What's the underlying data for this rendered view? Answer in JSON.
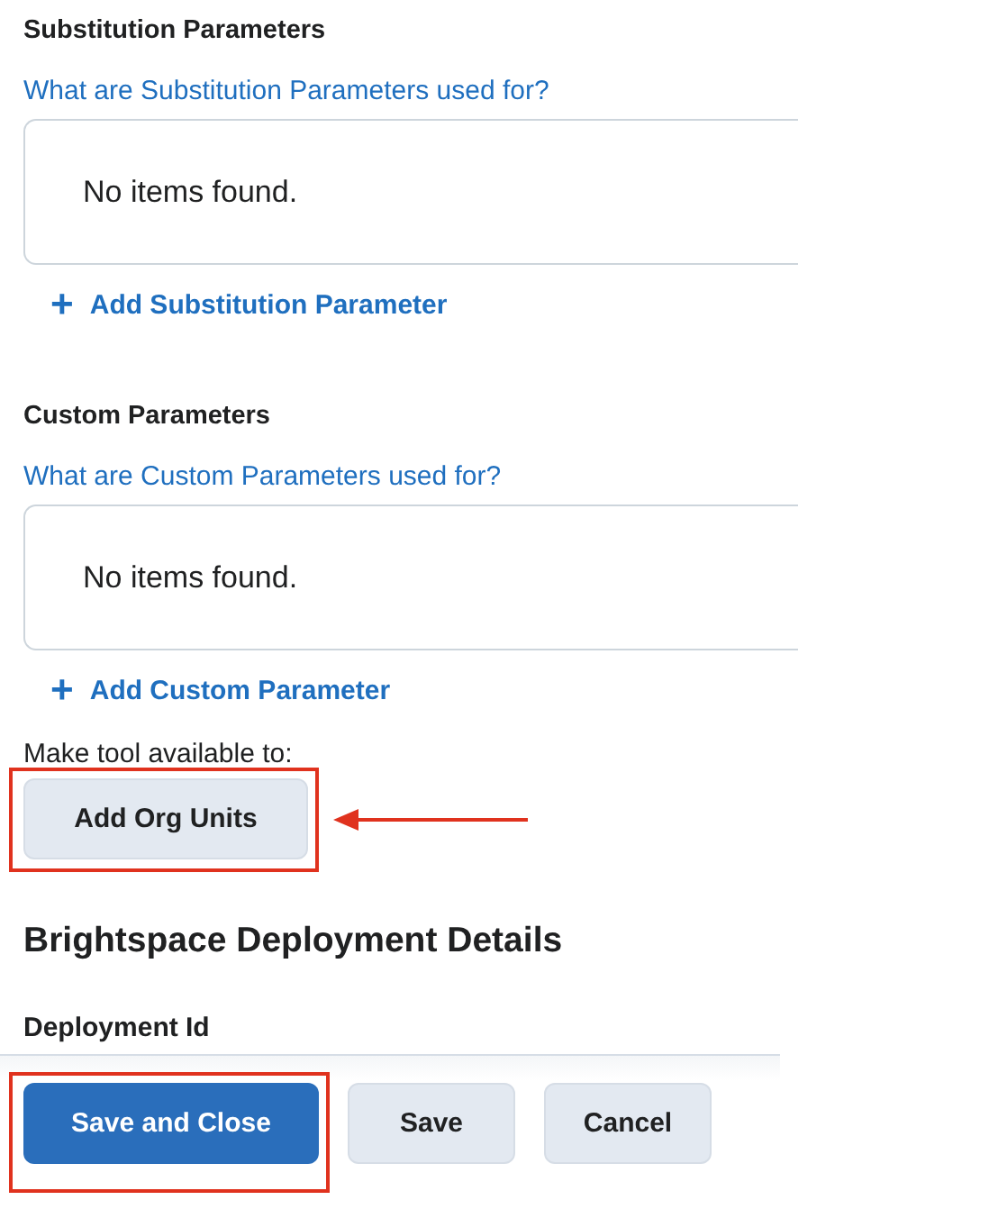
{
  "sections": [
    {
      "heading": "Substitution Parameters",
      "help_link": "What are Substitution Parameters used for?",
      "empty_text": "No items found.",
      "add_icon": "+",
      "add_link": "Add Substitution Parameter"
    },
    {
      "heading": "Custom Parameters",
      "help_link": "What are Custom Parameters used for?",
      "empty_text": "No items found.",
      "add_icon": "+",
      "add_link": "Add Custom Parameter"
    }
  ],
  "availability": {
    "label": "Make tool available to:",
    "button": "Add Org Units",
    "highlighted": true,
    "callout_arrow": true
  },
  "deployment": {
    "heading": "Brightspace Deployment Details",
    "field_label": "Deployment Id"
  },
  "footer": {
    "buttons": [
      {
        "label": "Save and Close",
        "kind": "primary",
        "highlighted": true
      },
      {
        "label": "Save",
        "kind": "secondary",
        "highlighted": false
      },
      {
        "label": "Cancel",
        "kind": "secondary",
        "highlighted": false
      }
    ]
  }
}
